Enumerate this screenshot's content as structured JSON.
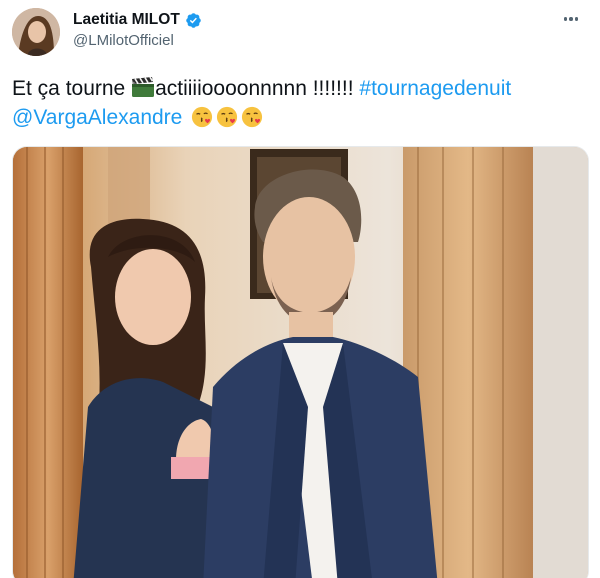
{
  "author": {
    "name": "Laetitia MILOT",
    "handle": "@LMilotOfficiel",
    "verified": true
  },
  "tweet": {
    "text_start": "Et ça tourne ",
    "text_action": "actiiiioooonnnnn !!!!!!! ",
    "hashtag": "#tournagedenuit",
    "mention": "@VargaAlexandre",
    "emoji_clapper": "clapper-board-icon",
    "emoji_kiss": "face-blowing-kiss-icon",
    "kiss_count": 3
  },
  "colors": {
    "link": "#1d9bf0",
    "text": "#0f1419",
    "secondary": "#536471",
    "verified": "#1d9bf0"
  },
  "icons": {
    "more": "more-options-icon",
    "verified": "verified-badge-icon"
  }
}
